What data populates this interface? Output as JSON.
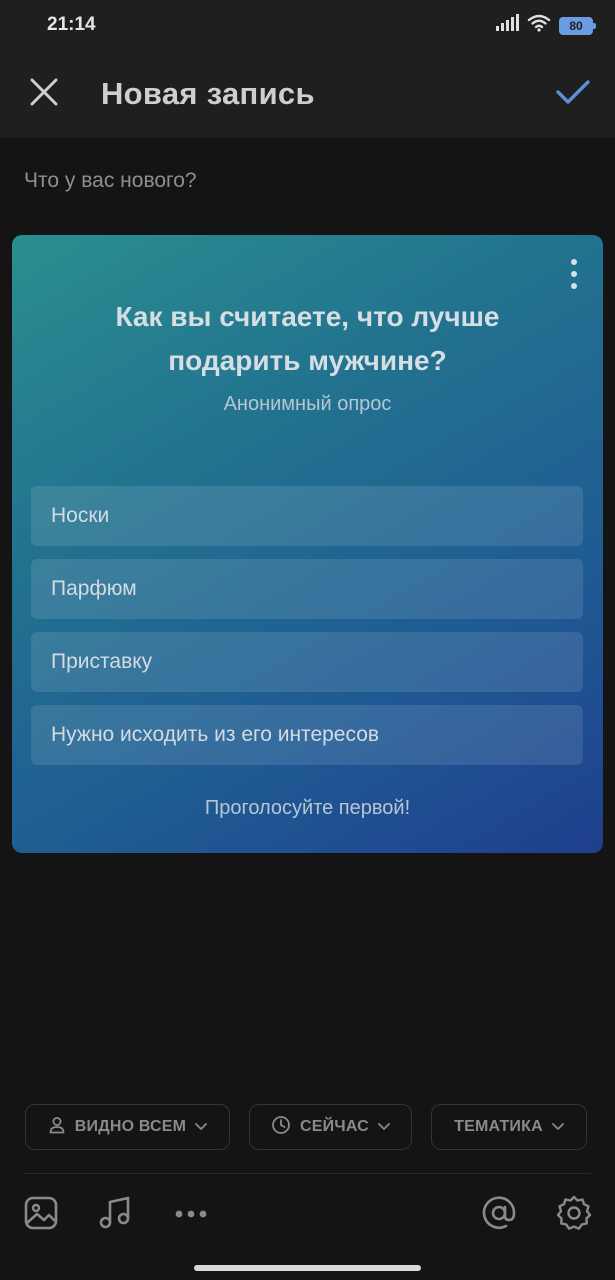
{
  "status_bar": {
    "time": "21:14",
    "battery": "80",
    "icons": [
      "signal-icon",
      "wifi-icon",
      "battery-icon"
    ]
  },
  "header": {
    "title": "Новая запись",
    "close_icon": "close-icon",
    "confirm_icon": "checkmark-icon"
  },
  "composer": {
    "placeholder": "Что у вас нового?",
    "value": ""
  },
  "poll": {
    "question": "Как вы считаете, что лучше подарить мужчине?",
    "type_label": "Анонимный опрос",
    "options": [
      "Носки",
      "Парфюм",
      "Приставку",
      "Нужно исходить из его интересов"
    ],
    "cta": "Проголосуйте первой!",
    "menu_icon": "more-vertical-icon"
  },
  "chips": {
    "visibility": "ВИДНО ВСЕМ",
    "time": "СЕЙЧАС",
    "topic": "ТЕМАТИКА"
  },
  "toolbar": {
    "icons": [
      "image-icon",
      "music-icon",
      "more-horizontal-icon",
      "mention-icon",
      "settings-icon"
    ]
  },
  "colors": {
    "background": "#141414",
    "header": "#1f1f1f",
    "accent": "#5b8fd6",
    "card_gradient_start": "#2a8e8f",
    "card_gradient_end": "#1f3f8d"
  }
}
